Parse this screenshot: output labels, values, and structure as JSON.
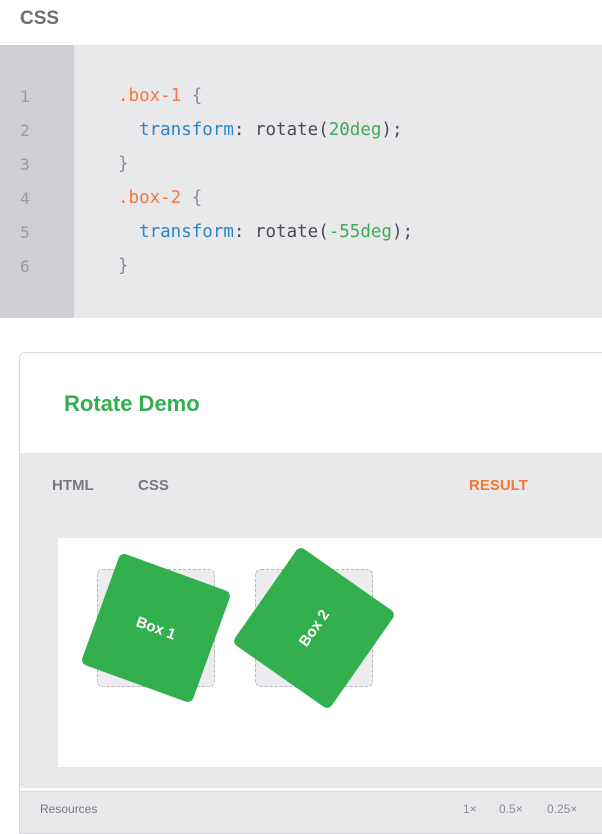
{
  "section_label": "CSS",
  "code": {
    "line_numbers": [
      "1",
      "2",
      "3",
      "4",
      "5",
      "6"
    ],
    "lines": [
      [
        {
          "t": ".box-1",
          "c": "sel"
        },
        {
          "t": " {",
          "c": "punc"
        }
      ],
      [
        {
          "t": "  ",
          "c": ""
        },
        {
          "t": "transform",
          "c": "prop"
        },
        {
          "t": ": rotate(",
          "c": ""
        },
        {
          "t": "20deg",
          "c": "num"
        },
        {
          "t": ");",
          "c": ""
        }
      ],
      [
        {
          "t": "}",
          "c": "punc"
        }
      ],
      [
        {
          "t": ".box-2",
          "c": "sel"
        },
        {
          "t": " {",
          "c": "punc"
        }
      ],
      [
        {
          "t": "  ",
          "c": ""
        },
        {
          "t": "transform",
          "c": "prop"
        },
        {
          "t": ": rotate(",
          "c": ""
        },
        {
          "t": "-55deg",
          "c": "num"
        },
        {
          "t": ");",
          "c": ""
        }
      ],
      [
        {
          "t": "}",
          "c": "punc"
        }
      ]
    ]
  },
  "demo": {
    "title": "Rotate Demo",
    "tabs": {
      "html": "HTML",
      "css": "CSS",
      "result": "RESULT"
    },
    "boxes": [
      {
        "label": "Box 1",
        "rotate_deg": 20
      },
      {
        "label": "Box 2",
        "rotate_deg": -55
      }
    ],
    "footer": {
      "resources": "Resources",
      "zoom_options": [
        "1×",
        "0.5×",
        "0.25×"
      ]
    }
  },
  "colors": {
    "accent_green": "#32b04e",
    "accent_orange": "#f0783c",
    "keyword_blue": "#2a86c6"
  }
}
